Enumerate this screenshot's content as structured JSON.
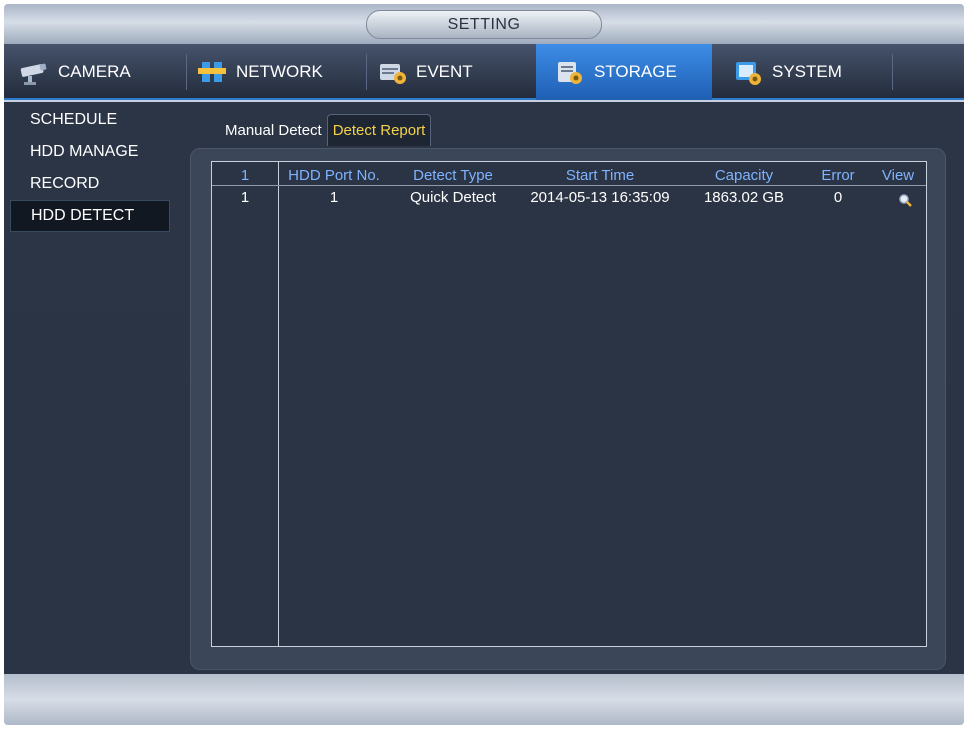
{
  "window": {
    "title": "SETTING"
  },
  "main_tabs": [
    {
      "label": "CAMERA",
      "icon": "camera-icon",
      "active": false
    },
    {
      "label": "NETWORK",
      "icon": "network-icon",
      "active": false
    },
    {
      "label": "EVENT",
      "icon": "event-icon",
      "active": false
    },
    {
      "label": "STORAGE",
      "icon": "storage-icon",
      "active": true
    },
    {
      "label": "SYSTEM",
      "icon": "system-icon",
      "active": false
    }
  ],
  "sidebar": {
    "items": [
      {
        "label": "SCHEDULE",
        "active": false
      },
      {
        "label": "HDD MANAGE",
        "active": false
      },
      {
        "label": "RECORD",
        "active": false
      },
      {
        "label": "HDD DETECT",
        "active": true
      }
    ]
  },
  "subtabs": [
    {
      "label": "Manual Detect",
      "active": false
    },
    {
      "label": "Detect Report",
      "active": true
    }
  ],
  "report_table": {
    "columns": [
      "1",
      "HDD Port No.",
      "Detect Type",
      "Start Time",
      "Capacity",
      "Error",
      "View"
    ],
    "rows": [
      {
        "index": "1",
        "port": "1",
        "type": "Quick Detect",
        "start_time": "2014-05-13 16:35:09",
        "capacity": "1863.02 GB",
        "error": "0",
        "view_icon": "magnifier-icon"
      }
    ]
  },
  "colors": {
    "active_tab": "#2f7fde",
    "header_text": "#7fb3ff",
    "active_subtab_text": "#f3d34a",
    "panel_bg": "#2b3546"
  }
}
